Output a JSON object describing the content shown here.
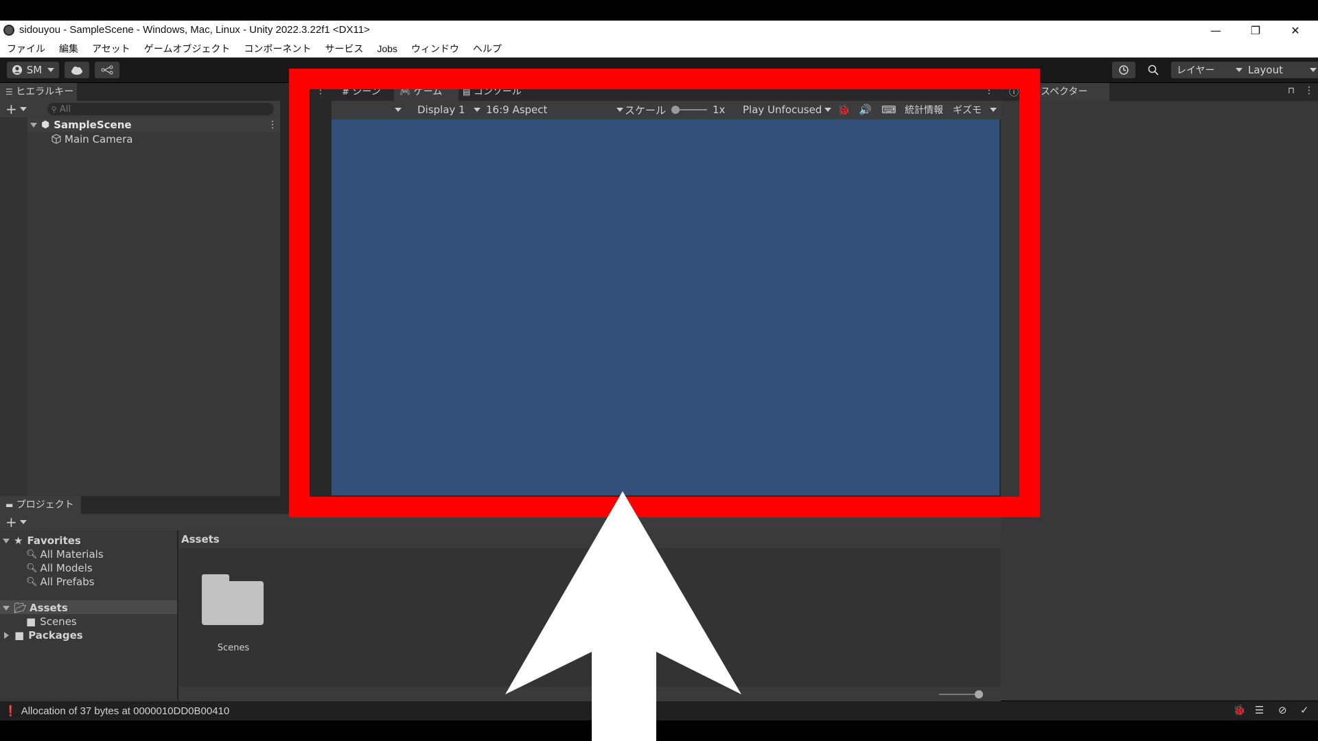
{
  "window": {
    "title": "sidouyou - SampleScene - Windows, Mac, Linux - Unity 2022.3.22f1 <DX11>",
    "minimize_glyph": "—",
    "restore_glyph": "❐",
    "close_glyph": "✕"
  },
  "menu": {
    "items": [
      "ファイル",
      "編集",
      "アセット",
      "ゲームオブジェクト",
      "コンポーネント",
      "サービス",
      "Jobs",
      "ウィンドウ",
      "ヘルプ"
    ]
  },
  "toolbar": {
    "account_label": "SM",
    "layers_label": "レイヤー",
    "layout_label": "Layout"
  },
  "hierarchy": {
    "tab_label": "ヒエラルキー",
    "search_placeholder": "All",
    "scene_name": "SampleScene",
    "objects": [
      "Main Camera"
    ]
  },
  "game_view": {
    "tabs": [
      {
        "label": "シーン",
        "icon": "grid-icon"
      },
      {
        "label": "ゲーム",
        "icon": "gamepad-icon"
      },
      {
        "label": "コンソール",
        "icon": "console-icon"
      }
    ],
    "display_label": "Display 1",
    "aspect_label": "16:9 Aspect",
    "scale_label": "スケール",
    "scale_value": "1x",
    "play_mode_label": "Play Unfocused",
    "stats_label": "統計情報",
    "gizmos_label": "ギズモ",
    "viewport_color": "#33507a"
  },
  "inspector": {
    "tab_label": "スペクター"
  },
  "project": {
    "tab_label": "プロジェクト",
    "favorites_label": "Favorites",
    "favorites": [
      "All Materials",
      "All Models",
      "All Prefabs"
    ],
    "assets_label": "Assets",
    "asset_children": [
      "Scenes"
    ],
    "packages_label": "Packages",
    "breadcrumb": "Assets",
    "grid_items": [
      "Scenes"
    ]
  },
  "status": {
    "message": "Allocation of 37 bytes at 0000010DD0B00410"
  },
  "annotation": {
    "frame_color": "#ff0000",
    "arrow_color": "#ffffff"
  }
}
